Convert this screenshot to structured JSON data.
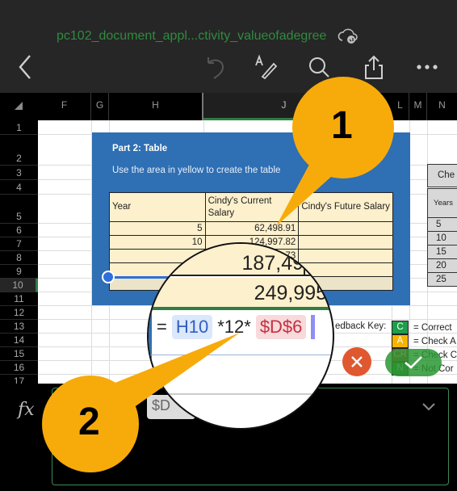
{
  "header": {
    "title": "pc102_document_appl...ctivity_valueofadegree",
    "icons": {
      "back": "chevron-left-icon",
      "undo": "undo-icon",
      "draw": "draw-pen-icon",
      "search": "search-icon",
      "share": "share-icon",
      "more": "more-icon",
      "cloud": "cloud-sync-icon"
    }
  },
  "grid": {
    "columns": [
      "F",
      "G",
      "H",
      "J",
      "L",
      "M",
      "N"
    ],
    "selected_column": "J",
    "rows": [
      "1",
      "2",
      "3",
      "4",
      "5",
      "6",
      "7",
      "8",
      "9",
      "10",
      "11",
      "12",
      "13",
      "14",
      "15",
      "16",
      "17"
    ],
    "selected_row": "10"
  },
  "panel": {
    "title": "Part 2: Table",
    "instruction": "Use the area in yellow to create the table",
    "table": {
      "headers": [
        "Year",
        "Cindy's Current Salary",
        "Cindy's Future Salary"
      ],
      "rows": [
        [
          "5",
          "62,498.91",
          ""
        ],
        [
          "10",
          "124,997.82",
          ""
        ],
        [
          "",
          "…73",
          ""
        ],
        [
          "",
          "",
          ""
        ],
        [
          "",
          "",
          ""
        ]
      ]
    }
  },
  "check_table": {
    "title": "Che",
    "header": "Years",
    "years": [
      "5",
      "10",
      "15",
      "20",
      "25"
    ]
  },
  "feedback_key": {
    "label": "edback Key:",
    "items": [
      {
        "code": "C",
        "text": "= Correct",
        "color": "#1e9e4a"
      },
      {
        "code": "A",
        "text": "= Check A",
        "color": "#f5b400"
      },
      {
        "code": "CR",
        "text": "= Check C",
        "color": "#c0392b"
      },
      {
        "code": "N",
        "text": "= Not Cor",
        "color": "#2f7a2f"
      }
    ]
  },
  "magnifier": {
    "value1": "187,49",
    "value2": "249,995.",
    "formula": {
      "equals": "=",
      "ref1": "H10",
      "mid": "*12*",
      "ref2": "$D$6"
    }
  },
  "formula_bar": {
    "fx_label": "fx",
    "chip_text": "$D",
    "expand_icon": "chevron-down-icon"
  },
  "actions": {
    "cancel": "cancel-icon",
    "confirm": "checkmark-icon"
  },
  "callouts": {
    "one": "1",
    "two": "2"
  },
  "colors": {
    "accent_green": "#2e8b3e",
    "callout": "#f7ab0a",
    "panel_blue": "#2f6fb3",
    "cell_yellow": "#fdf0cc"
  }
}
